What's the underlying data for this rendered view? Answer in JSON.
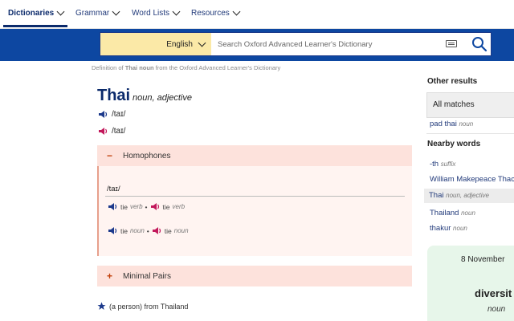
{
  "nav": {
    "items": [
      {
        "label": "Dictionaries"
      },
      {
        "label": "Grammar"
      },
      {
        "label": "Word Lists"
      },
      {
        "label": "Resources"
      }
    ]
  },
  "search": {
    "language": "English",
    "placeholder": "Search Oxford Advanced Learner's Dictionary"
  },
  "breadcrumb": {
    "prefix": "Definition of ",
    "term": "Thai noun",
    "suffix": " from the Oxford Advanced Learner's Dictionary"
  },
  "entry": {
    "headword": "Thai",
    "pos": "noun, adjective",
    "pron_uk": "/taɪ/",
    "pron_us": "/taɪ/",
    "homophones": {
      "title": "Homophones",
      "pron": "/taɪ/",
      "rows": [
        {
          "w1": "tie",
          "p1": "verb",
          "sep": "•",
          "w2": "tie",
          "p2": "verb"
        },
        {
          "w1": "tie",
          "p1": "noun",
          "sep": "•",
          "w2": "tie",
          "p2": "noun"
        }
      ]
    },
    "minimal_pairs": {
      "title": "Minimal Pairs"
    },
    "sense_note": "(a person) from Thailand"
  },
  "sidebar": {
    "other_results_title": "Other results",
    "all_matches": "All matches",
    "other_results": [
      {
        "word": "pad thai",
        "pos": "noun"
      }
    ],
    "nearby_title": "Nearby words",
    "nearby": [
      {
        "word": "-th",
        "pos": "suffix"
      },
      {
        "word": "William Makepeace Thac",
        "pos": ""
      },
      {
        "word": "Thai",
        "pos": "noun, adjective"
      },
      {
        "word": "Thailand",
        "pos": "noun"
      },
      {
        "word": "thakur",
        "pos": "noun"
      }
    ],
    "wotd": {
      "date": "8 November",
      "word": "diversit",
      "pos": "noun"
    }
  },
  "colors": {
    "brand_blue": "#0d47a1",
    "navy": "#0b2a6b",
    "language_bg": "#fbe9a7",
    "panel_pink": "#fde2dc",
    "wotd_green": "#e7f6ea"
  }
}
